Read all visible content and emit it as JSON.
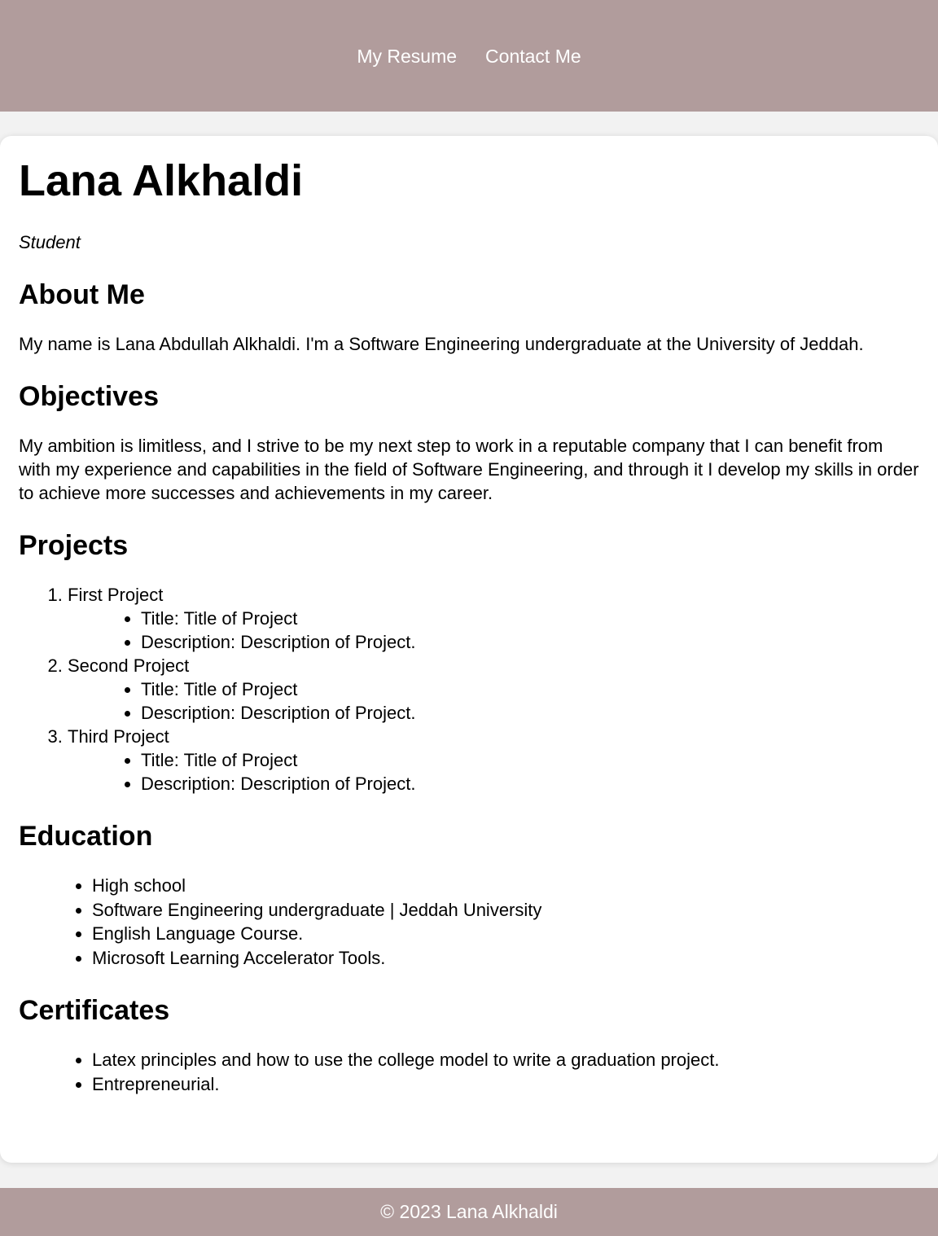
{
  "nav": {
    "links": [
      "My Resume",
      "Contact Me"
    ]
  },
  "profile": {
    "name": "Lana Alkhaldi",
    "role": "Student"
  },
  "about": {
    "heading": "About Me",
    "text": "My name is Lana Abdullah Alkhaldi. I'm a Software Engineering undergraduate at the University of Jeddah."
  },
  "objectives": {
    "heading": "Objectives",
    "text": "My ambition is limitless, and I strive to be my next step to work in a reputable company that I can benefit from with my experience and capabilities in the field of Software Engineering, and through it I develop my skills in order to achieve more successes and achievements in my career."
  },
  "projects": {
    "heading": "Projects",
    "items": [
      {
        "name": "First Project",
        "title": "Title: Title of Project",
        "description": "Description: Description of Project."
      },
      {
        "name": "Second Project",
        "title": "Title: Title of Project",
        "description": "Description: Description of Project."
      },
      {
        "name": "Third Project",
        "title": "Title: Title of Project",
        "description": "Description: Description of Project."
      }
    ]
  },
  "education": {
    "heading": "Education",
    "items": [
      "High school",
      "Software Engineering undergraduate | Jeddah University",
      "English Language Course.",
      "Microsoft Learning Accelerator Tools."
    ]
  },
  "certificates": {
    "heading": "Certificates",
    "items": [
      "Latex principles and how to use the college model to write a graduation project.",
      "Entrepreneurial."
    ]
  },
  "footer": {
    "text": "© 2023 Lana Alkhaldi"
  },
  "colors": {
    "header_bg": "#b19c9c",
    "page_bg": "#f2f2f2",
    "card_bg": "#ffffff"
  }
}
